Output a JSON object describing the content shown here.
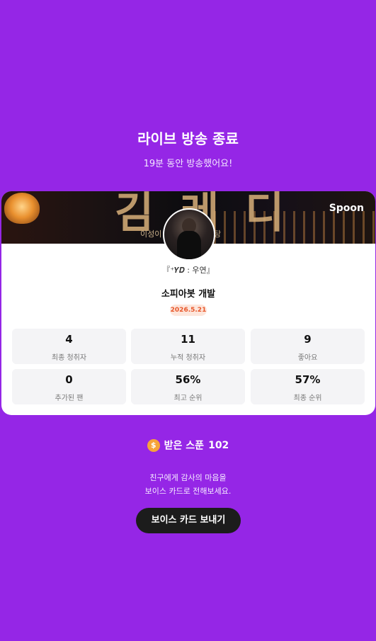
{
  "header": {
    "title": "라이브 방송 종료",
    "subtitle": "19분 동안 방송했어요!"
  },
  "card": {
    "banner": {
      "big_text": "김 레 디",
      "sub_text_left": "이성이",
      "sub_text_right": "탕",
      "brand": "Spoon"
    },
    "dj_nickname": "『⁺𝒀𝑫 : 우연』",
    "live_title": "소피아봇 개발",
    "date": "2026.5.21",
    "stats": [
      {
        "value": "4",
        "label": "최종 청취자"
      },
      {
        "value": "11",
        "label": "누적 청취자"
      },
      {
        "value": "9",
        "label": "좋아요"
      },
      {
        "value": "0",
        "label": "추가된 팬"
      },
      {
        "value": "56%",
        "label": "최고 순위"
      },
      {
        "value": "57%",
        "label": "최종 순위"
      }
    ]
  },
  "spoons": {
    "icon": "spoon-coin-icon",
    "coin_glyph": "$",
    "label": "받은 스푼",
    "value": "102"
  },
  "message": {
    "line1": "친구에게 감사의 마음을",
    "line2": "보이스 카드로 전해보세요."
  },
  "send_button": "보이스 카드 보내기",
  "colors": {
    "background": "#9526e6",
    "date_badge_bg": "#fde6dc",
    "date_badge_text": "#e8572a",
    "coin": "#f6a33a",
    "button": "#1c1c1c"
  }
}
